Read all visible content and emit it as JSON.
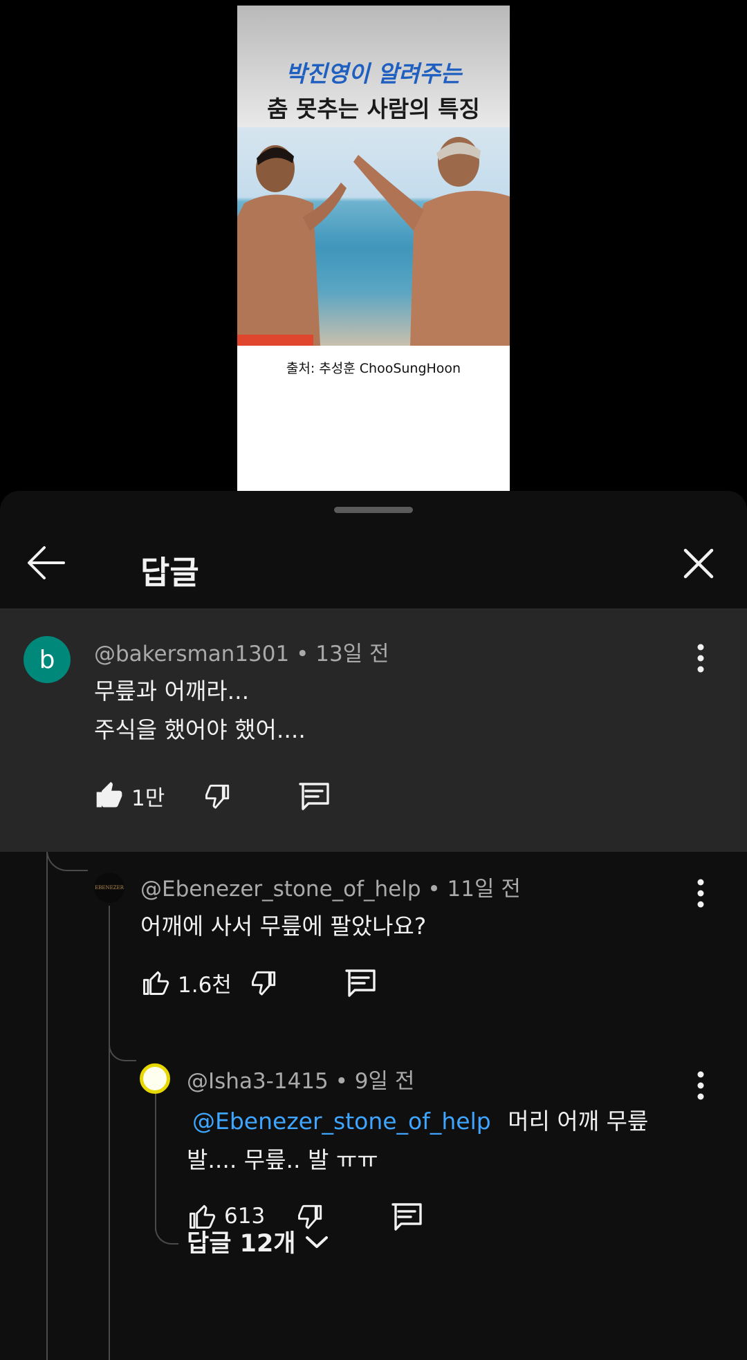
{
  "video": {
    "headline_1": "박진영이 알려주는",
    "headline_2": "춤 못추는 사람의 특징",
    "credit": "출처: 추성훈 ChooSungHoon"
  },
  "panel": {
    "title": "답글"
  },
  "comments": [
    {
      "avatar_letter": "b",
      "author": "@bakersman1301",
      "time": "13일 전",
      "lines": [
        "무릎과 어깨라...",
        "주식을 했어야 했어...."
      ],
      "likes": "1만"
    },
    {
      "avatar_text": "EBENEZER",
      "author": "@Ebenezer_stone_of_help",
      "time": "11일 전",
      "lines": [
        "어깨에 사서 무릎에 팔았나요?"
      ],
      "likes": "1.6천"
    },
    {
      "author": "@Isha3-1415",
      "time": "9일 전",
      "mention": "@Ebenezer_stone_of_help",
      "line1_rest": "머리 어깨 무릎",
      "line2": "발.... 무릎.. 발 ㅠㅠ",
      "likes": "613"
    }
  ],
  "more_replies": "답글 12개",
  "colors": {
    "accent_mention": "#3ea6ff",
    "avatar_b": "#00897b",
    "highlight_bg": "#272727",
    "sheet_bg": "#0f0f0f"
  },
  "icons": [
    "arrow-left-icon",
    "close-icon",
    "more-vert-icon",
    "thumb-up-icon",
    "thumb-down-icon",
    "reply-icon",
    "chevron-down-icon"
  ]
}
